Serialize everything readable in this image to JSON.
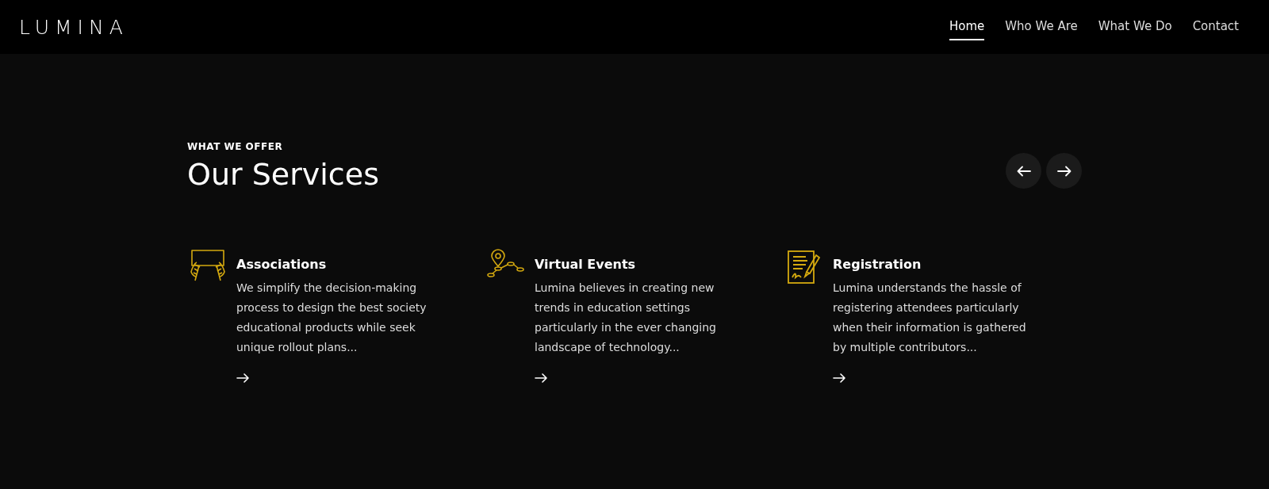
{
  "logo": "LUMINA",
  "nav": [
    {
      "label": "Home",
      "selected": true
    },
    {
      "label": "Who We Are",
      "selected": false
    },
    {
      "label": "What We Do",
      "selected": false
    },
    {
      "label": "Contact",
      "selected": false
    }
  ],
  "eyebrow": "WHAT WE OFFER",
  "heading": "Our Services",
  "services": [
    {
      "kind": "hands",
      "title": "Associations",
      "description": "We simplify the decision-making process to design the best society educational products while seek unique rollout plans..."
    },
    {
      "kind": "route",
      "title": "Virtual Events",
      "description": "Lumina believes in creating new trends in education settings particularly in the ever changing landscape of technology..."
    },
    {
      "kind": "document",
      "title": "Registration",
      "description": "Lumina understands the hassle of registering attendees particularly when their information is gathered by multiple contributors..."
    }
  ]
}
